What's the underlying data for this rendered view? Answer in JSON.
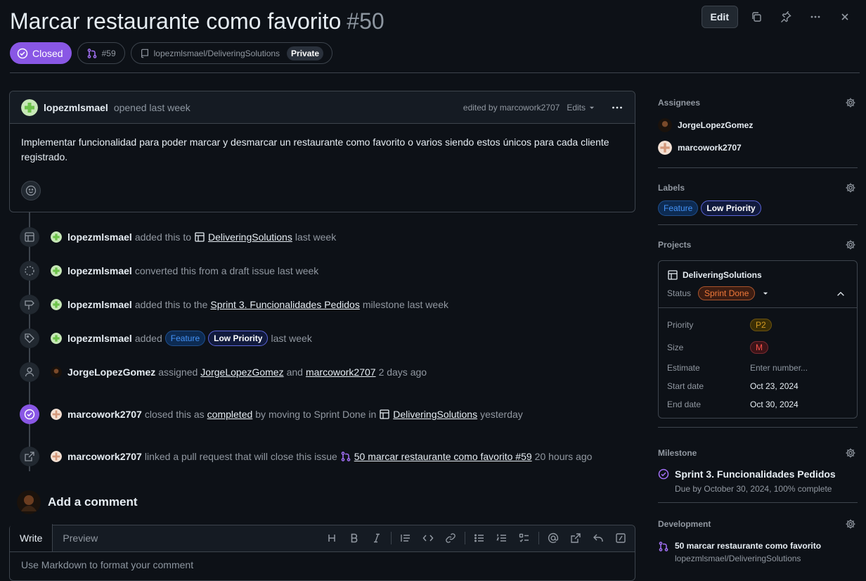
{
  "issue": {
    "title": "Marcar restaurante como favorito",
    "number": "#50",
    "state": "Closed",
    "linked_pr": "#59",
    "repo": "lopezmlsmael/DeliveringSolutions",
    "visibility": "Private"
  },
  "header": {
    "edit_label": "Edit"
  },
  "comment": {
    "author": "lopezmlsmael",
    "action": "opened last week",
    "edited_by": "edited by marcowork2707",
    "edits_label": "Edits",
    "body": "Implementar funcionalidad para poder marcar y desmarcar un restaurante como favorito o varios siendo estos únicos para cada cliente registrado."
  },
  "timeline": [
    {
      "actor": "lopezmlsmael",
      "pre": "added this to",
      "link": "DeliveringSolutions",
      "post": "last week"
    },
    {
      "actor": "lopezmlsmael",
      "pre": "converted this from a draft issue last week"
    },
    {
      "actor": "lopezmlsmael",
      "pre": "added this to the",
      "link": "Sprint 3. Funcionalidades Pedidos",
      "post": "milestone last week"
    },
    {
      "actor": "lopezmlsmael",
      "pre": "added",
      "label1": "Feature",
      "label2": "Low Priority",
      "post": "last week"
    },
    {
      "actor": "JorgeLopezGomez",
      "pre": "assigned",
      "link": "JorgeLopezGomez",
      "mid": "and",
      "link2": "marcowork2707",
      "post": "2 days ago"
    },
    {
      "actor": "marcowork2707",
      "pre": "closed this as",
      "link": "completed",
      "mid": "by moving to Sprint Done in",
      "link2": "DeliveringSolutions",
      "post": "yesterday"
    },
    {
      "actor": "marcowork2707",
      "pre": "linked a pull request that will close this issue",
      "link": "50 marcar restaurante como favorito #59",
      "post": "20 hours ago"
    }
  ],
  "add_comment": {
    "heading": "Add a comment",
    "tab_write": "Write",
    "tab_preview": "Preview",
    "placeholder": "Use Markdown to format your comment"
  },
  "sidebar": {
    "assignees_title": "Assignees",
    "assignees": [
      "JorgeLopezGomez",
      "marcowork2707"
    ],
    "labels_title": "Labels",
    "labels": [
      "Feature",
      "Low Priority"
    ],
    "projects_title": "Projects",
    "project": {
      "name": "DeliveringSolutions",
      "status_label": "Status",
      "status_value": "Sprint Done",
      "fields": [
        {
          "key": "Priority",
          "value": "P2"
        },
        {
          "key": "Size",
          "value": "M"
        },
        {
          "key": "Estimate",
          "value": "Enter number..."
        },
        {
          "key": "Start date",
          "value": "Oct 23, 2024"
        },
        {
          "key": "End date",
          "value": "Oct 30, 2024"
        }
      ]
    },
    "milestone_title": "Milestone",
    "milestone_name": "Sprint 3. Funcionalidades Pedidos",
    "milestone_sub": "Due by October 30, 2024, 100% complete",
    "development_title": "Development",
    "dev_pr_title": "50 marcar restaurante como favorito",
    "dev_pr_repo": "lopezmlsmael/DeliveringSolutions"
  },
  "colors": {
    "closed": "#8957e5",
    "bg": "#0d1117",
    "border": "#3d444d"
  }
}
